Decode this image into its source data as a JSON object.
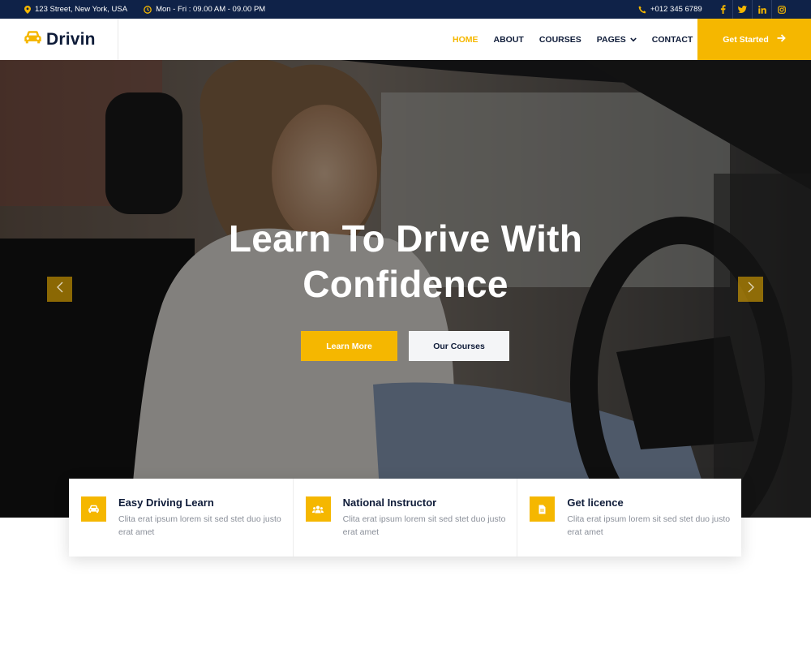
{
  "topbar": {
    "address": "123 Street, New York, USA",
    "hours": "Mon - Fri : 09.00 AM - 09.00 PM",
    "phone": "+012 345 6789",
    "socials": [
      {
        "name": "facebook",
        "glyph": "f"
      },
      {
        "name": "twitter",
        "glyph": "twitter-bird"
      },
      {
        "name": "linkedin",
        "glyph": "in"
      },
      {
        "name": "instagram",
        "glyph": "instagram-camera"
      }
    ]
  },
  "brand": {
    "name": "Drivin",
    "icon": "car-icon"
  },
  "nav": {
    "items": [
      "HOME",
      "ABOUT",
      "COURSES",
      "PAGES",
      "CONTACT"
    ],
    "active": "HOME",
    "cta": "Get Started"
  },
  "hero": {
    "title_line1": "Learn To Drive With",
    "title_line2": "Confidence",
    "primary_button": "Learn More",
    "secondary_button": "Our Courses"
  },
  "features": [
    {
      "icon": "car-icon",
      "title": "Easy Driving Learn",
      "desc": "Clita erat ipsum lorem sit sed stet duo justo erat amet"
    },
    {
      "icon": "users-icon",
      "title": "National Instructor",
      "desc": "Clita erat ipsum lorem sit sed stet duo justo erat amet"
    },
    {
      "icon": "file-icon",
      "title": "Get licence",
      "desc": "Clita erat ipsum lorem sit sed stet duo justo erat amet"
    }
  ],
  "colors": {
    "accent": "#f5b700",
    "dark": "#0f2248",
    "text": "#0e1b38",
    "muted": "#8a8f99"
  }
}
